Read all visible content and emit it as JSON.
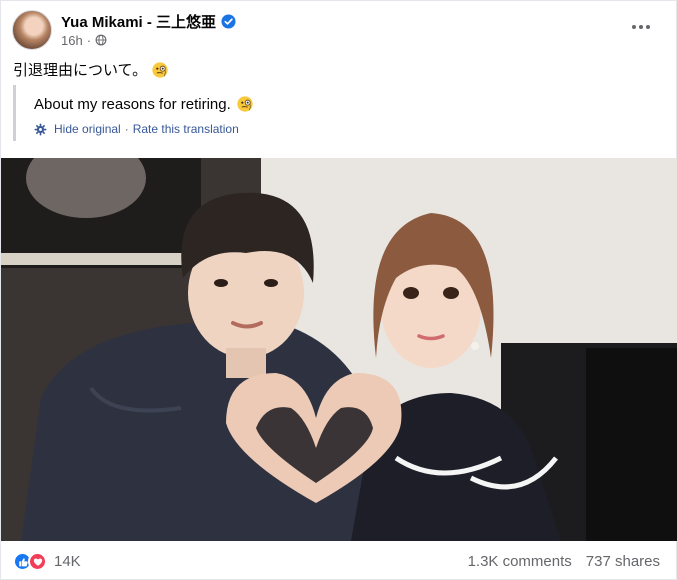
{
  "post": {
    "author": "Yua Mikami - 三上悠亜",
    "timestamp": "16h",
    "meta_separator": "·",
    "text": "引退理由について。",
    "text_emoji": "monocle-face-emoji",
    "translation": {
      "text": "About my reasons for retiring.",
      "hide_label": "Hide original",
      "separator": "·",
      "rate_label": "Rate this translation"
    },
    "reactions": {
      "count": "14K",
      "types": [
        "like",
        "love"
      ]
    },
    "comments": "1.3K comments",
    "shares": "737 shares"
  },
  "colors": {
    "verified": "#1b74e4",
    "like": "#1877f2",
    "love": "#f33e58",
    "link": "#385898",
    "secondary_text": "#65676b"
  },
  "icons": {
    "verified": "verified-badge-icon",
    "audience": "globe-icon",
    "translation": "gear-icon",
    "more": "more-options-icon"
  }
}
